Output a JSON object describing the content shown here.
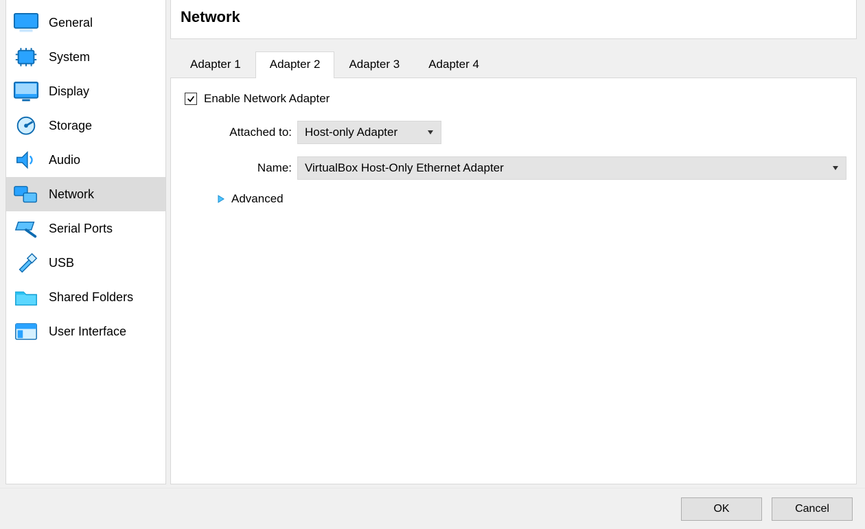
{
  "header": {
    "title": "Network"
  },
  "sidebar": {
    "items": [
      {
        "label": "General",
        "icon": "general",
        "selected": false
      },
      {
        "label": "System",
        "icon": "system",
        "selected": false
      },
      {
        "label": "Display",
        "icon": "display",
        "selected": false
      },
      {
        "label": "Storage",
        "icon": "storage",
        "selected": false
      },
      {
        "label": "Audio",
        "icon": "audio",
        "selected": false
      },
      {
        "label": "Network",
        "icon": "network",
        "selected": true
      },
      {
        "label": "Serial Ports",
        "icon": "serial",
        "selected": false
      },
      {
        "label": "USB",
        "icon": "usb",
        "selected": false
      },
      {
        "label": "Shared Folders",
        "icon": "shared-folders",
        "selected": false
      },
      {
        "label": "User Interface",
        "icon": "ui",
        "selected": false
      }
    ]
  },
  "tabs": [
    {
      "label": "Adapter 1",
      "active": false
    },
    {
      "label": "Adapter 2",
      "active": true
    },
    {
      "label": "Adapter 3",
      "active": false
    },
    {
      "label": "Adapter 4",
      "active": false
    }
  ],
  "form": {
    "enable_label": "Enable Network Adapter",
    "enable_checked": true,
    "attached_label": "Attached to:",
    "attached_value": "Host-only Adapter",
    "name_label": "Name:",
    "name_value": "VirtualBox Host-Only Ethernet Adapter",
    "advanced_label": "Advanced"
  },
  "footer": {
    "ok": "OK",
    "cancel": "Cancel"
  }
}
